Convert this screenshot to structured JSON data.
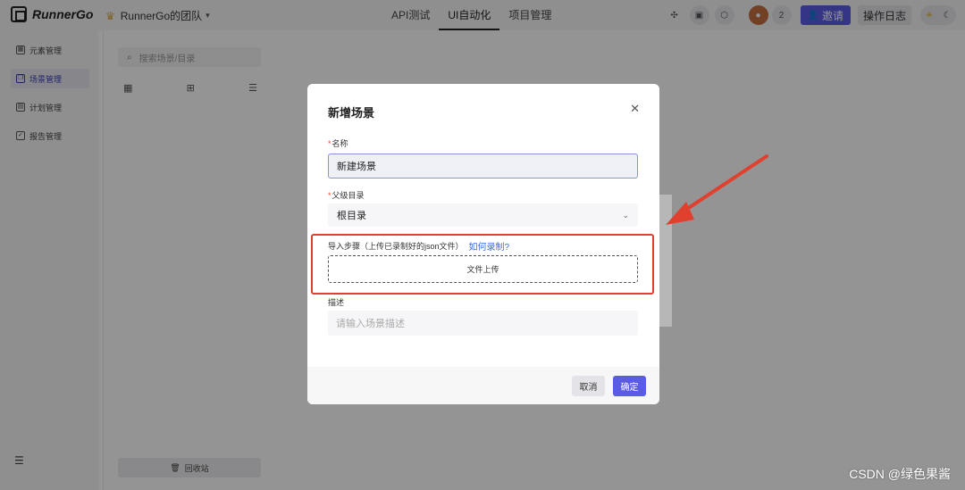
{
  "header": {
    "logo_text": "RunnerGo",
    "team_name": "RunnerGo的团队",
    "nav": [
      {
        "label": "API测试"
      },
      {
        "label": "UI自动化"
      },
      {
        "label": "项目管理"
      }
    ],
    "member_count": "2",
    "invite_label": "邀请",
    "log_label": "操作日志"
  },
  "sidebar": {
    "items": [
      {
        "label": "元素管理"
      },
      {
        "label": "场景管理"
      },
      {
        "label": "计划管理"
      },
      {
        "label": "报告管理"
      }
    ]
  },
  "tree": {
    "search_placeholder": "搜索场景/目录",
    "recycle_label": "回收站"
  },
  "modal": {
    "title": "新增场景",
    "name_label": "名称",
    "name_value": "新建场景",
    "parent_label": "父级目录",
    "parent_value": "根目录",
    "import_label": "导入步骤（上传已录制好的json文件）",
    "import_link": "如何录制?",
    "upload_label": "文件上传",
    "desc_label": "描述",
    "desc_placeholder": "请输入场景描述",
    "cancel_label": "取消",
    "confirm_label": "确定"
  },
  "annotation": {
    "color": "#e0412f"
  },
  "watermark": "CSDN @绿色果酱",
  "colors": {
    "accent": "#5b5ce6",
    "link": "#3b6ce6"
  }
}
